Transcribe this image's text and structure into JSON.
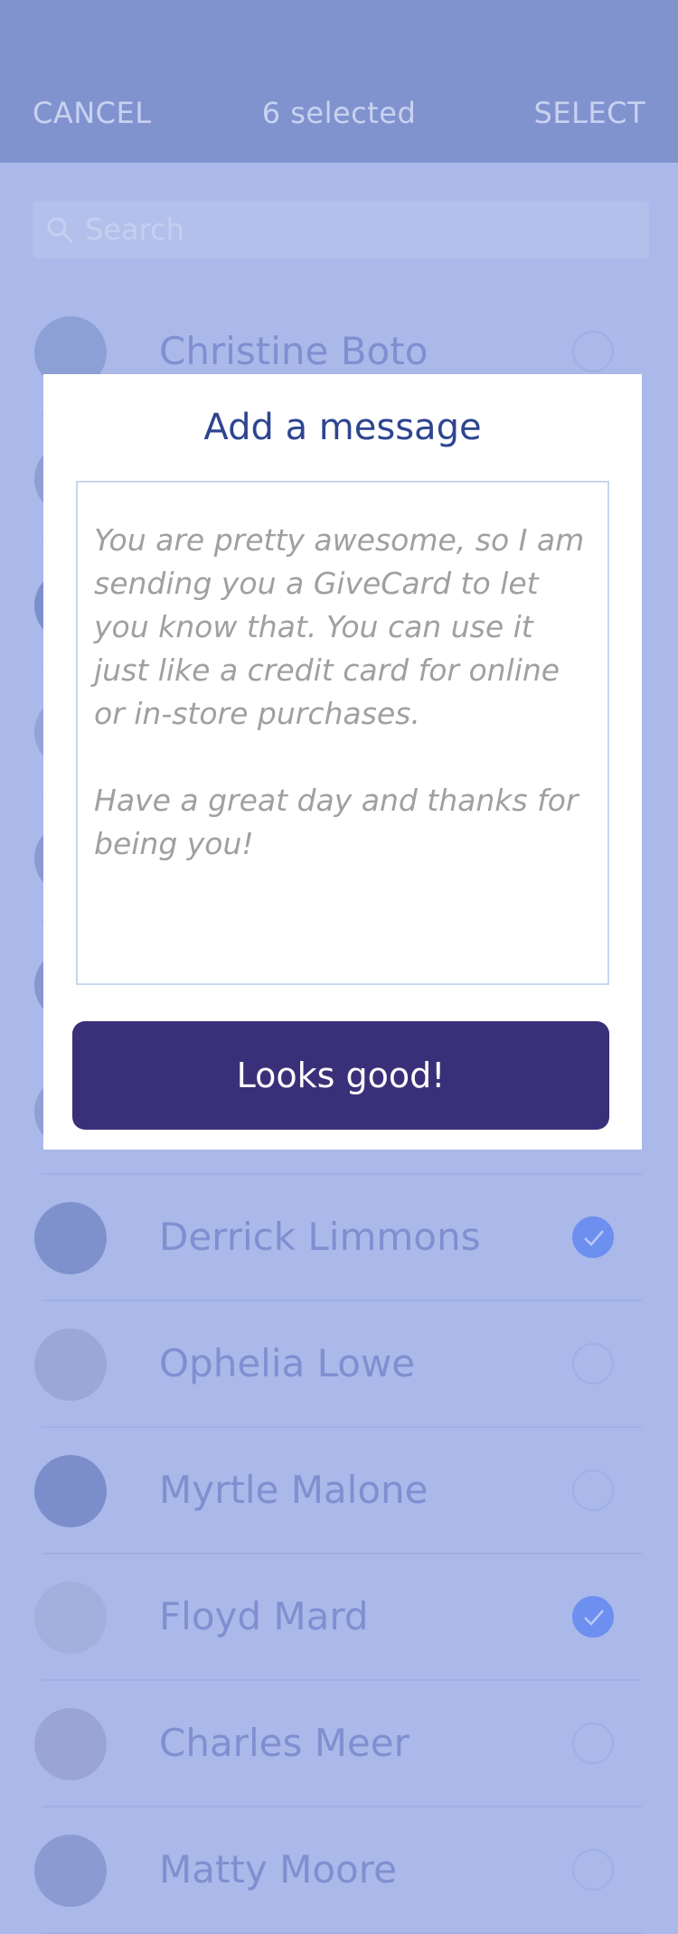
{
  "header": {
    "cancel_label": "CANCEL",
    "selected_count": "6 selected",
    "select_label": "SELECT"
  },
  "search": {
    "placeholder": "Search"
  },
  "contacts": [
    {
      "name": "Christine Boto",
      "checked": false,
      "avatar_color": "#8da0d6"
    },
    {
      "name": "",
      "checked": false,
      "avatar_color": "#8e9fd4"
    },
    {
      "name": "",
      "checked": false,
      "avatar_color": "#7c8fcb"
    },
    {
      "name": "",
      "checked": false,
      "avatar_color": "#93a3d8"
    },
    {
      "name": "",
      "checked": false,
      "avatar_color": "#8a9bd3"
    },
    {
      "name": "",
      "checked": false,
      "avatar_color": "#8697cf"
    },
    {
      "name": "",
      "checked": false,
      "avatar_color": "#8fa0d5"
    },
    {
      "name": "Derrick Limmons",
      "checked": true,
      "avatar_color": "#7f91cc"
    },
    {
      "name": "Ophelia Lowe",
      "checked": false,
      "avatar_color": "#9aa8d9"
    },
    {
      "name": "Myrtle Malone",
      "checked": false,
      "avatar_color": "#7b8ecb"
    },
    {
      "name": "Floyd Mard",
      "checked": true,
      "avatar_color": "#a3afdc"
    },
    {
      "name": "Charles Meer",
      "checked": false,
      "avatar_color": "#9aa5d6"
    },
    {
      "name": "Matty Moore",
      "checked": false,
      "avatar_color": "#8b9bd2"
    }
  ],
  "modal": {
    "title": "Add a message",
    "message_para1": "You are pretty awesome, so I am sending you a GiveCard to let you know that.  You can use it just like a credit card for online or in-store purchases.",
    "message_para2": "Have a great day and thanks for being you!",
    "confirm_label": "Looks good!"
  },
  "colors": {
    "overlay": "#aab9e9",
    "header": "#8193cf",
    "check_accent": "#6d8ff0",
    "button": "#3a3079",
    "title": "#2e4590"
  }
}
